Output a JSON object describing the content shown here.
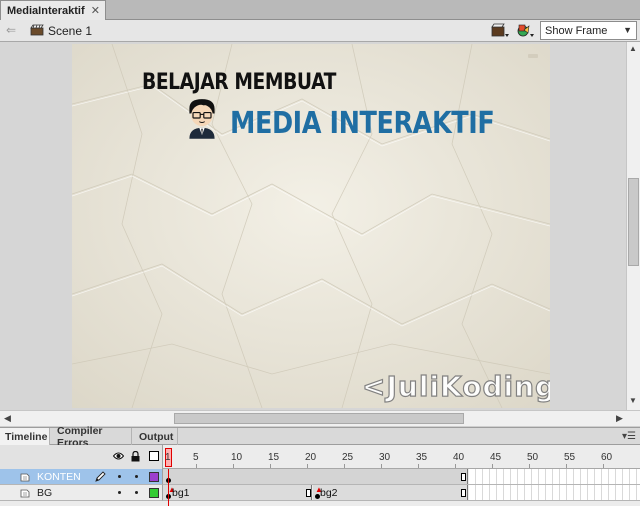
{
  "document": {
    "tab_title": "MediaInteraktif",
    "tab_close": "✕"
  },
  "editbar": {
    "scene_label": "Scene 1",
    "zoom_value": "Show Frame"
  },
  "stage": {
    "heading_line1": "BELAJAR MEMBUAT",
    "heading_line2": "MEDIA INTERAKTIF",
    "watermark": "<JuliKoding/>",
    "colors": {
      "paper": "#eeeadf",
      "title_blue": "#1f6ea3",
      "title_dark": "#111111",
      "watermark": "#8e8e8e"
    }
  },
  "panel_tabs": [
    {
      "label": "Timeline",
      "active": true
    },
    {
      "label": "Compiler Errors",
      "active": false
    },
    {
      "label": "Output",
      "active": false
    }
  ],
  "timeline": {
    "ruler_numbers": [
      "1",
      "5",
      "10",
      "15",
      "20",
      "25",
      "30",
      "35",
      "40",
      "45",
      "50",
      "55",
      "60"
    ],
    "layers": [
      {
        "name": "KONTEN",
        "selected": true,
        "swatch_color": "#9b3fcf"
      },
      {
        "name": "BG",
        "selected": false,
        "swatch_color": "#33cc33",
        "frame_labels": [
          "bg1",
          "bg2"
        ]
      }
    ]
  }
}
